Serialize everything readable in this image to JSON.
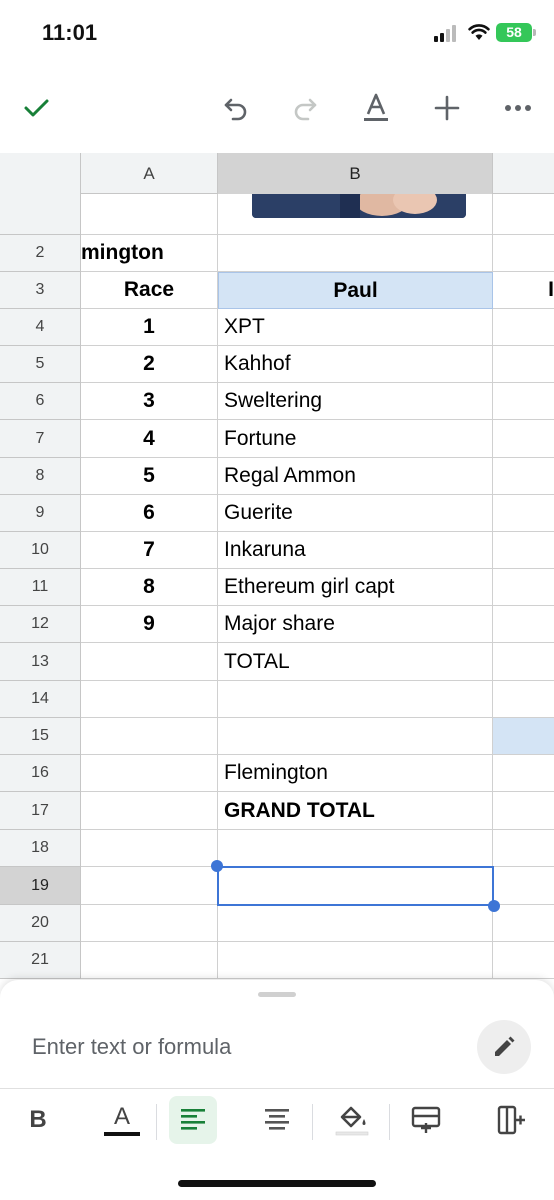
{
  "status_bar": {
    "time": "11:01",
    "battery": "58"
  },
  "sheet": {
    "column_headers": [
      "A",
      "B"
    ],
    "row_numbers": [
      "2",
      "3",
      "4",
      "5",
      "6",
      "7",
      "8",
      "9",
      "10",
      "11",
      "12",
      "13",
      "14",
      "15",
      "16",
      "17",
      "18",
      "19",
      "20",
      "21"
    ],
    "cells": {
      "a2": "mington",
      "a3": "Race",
      "b3": "Paul",
      "a4": "1",
      "b4": "XPT",
      "a5": "2",
      "b5": "Kahhof",
      "a6": "3",
      "b6": "Sweltering",
      "a7": "4",
      "b7": "Fortune",
      "a8": "5",
      "b8": "Regal Ammon",
      "a9": "6",
      "b9": "Guerite",
      "a10": "7",
      "b10": "Inkaruna",
      "a11": "8",
      "b11": "Ethereum girl capt",
      "a12": "9",
      "b12": "Major share",
      "b13": "TOTAL",
      "b16": "Flemington",
      "b17": "GRAND TOTAL",
      "c3_partial": "I"
    },
    "selected_cell": "B19"
  },
  "formula_bar": {
    "placeholder": "Enter text or formula"
  },
  "format_bar": {
    "bold_label": "B",
    "text_color_label": "A"
  },
  "colors": {
    "accent_green": "#188038",
    "selection_blue": "#3d75d6",
    "header_highlight": "#d4e4f5"
  }
}
